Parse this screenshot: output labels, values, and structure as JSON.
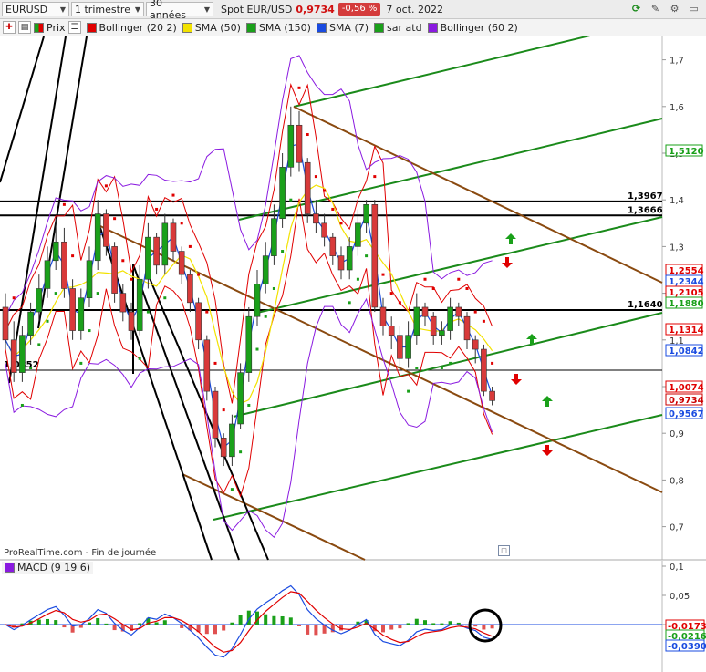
{
  "toolbar": {
    "symbol": "EURUSD",
    "period": "1 trimestre",
    "range": "30 années",
    "spot_label": "Spot EUR/USD",
    "price": "0,9734",
    "change": "-0,56 %",
    "date": "7 oct. 2022",
    "icons": [
      "refresh-icon",
      "drawing-tool-icon",
      "settings-icon",
      "window-icon"
    ]
  },
  "indicators": {
    "price_label": "Prix",
    "items": [
      {
        "label": "Bollinger (20 2)",
        "color": "#e00000"
      },
      {
        "label": "SMA (50)",
        "color": "#f2e200"
      },
      {
        "label": "SMA (150)",
        "color": "#1aa01a"
      },
      {
        "label": "SMA (7)",
        "color": "#1a4be0"
      },
      {
        "label": "sar atd",
        "color": "#1aa01a"
      },
      {
        "label": "Bollinger (60 2)",
        "color": "#8a1ae0"
      }
    ]
  },
  "footer": "ProRealTime.com - Fin de journée",
  "chart_data": {
    "type": "line",
    "title": "",
    "ylim": [
      0.65,
      1.78
    ],
    "price_axis_ticks": [
      "1,7",
      "1,6",
      "1,5",
      "1,4",
      "1,3",
      "1,2",
      "1,1",
      "1",
      "0,9",
      "0,8",
      "0,7"
    ],
    "price_tags": [
      {
        "text": "1,5120",
        "color": "#1aa01a"
      },
      {
        "text": "1,2554",
        "color": "#e00000"
      },
      {
        "text": "1,2344",
        "color": "#1a4be0"
      },
      {
        "text": "1,2105",
        "color": "#e00000"
      },
      {
        "text": "1,1880",
        "color": "#1aa01a"
      },
      {
        "text": "1,1314",
        "color": "#e00000"
      },
      {
        "text": "1,0842",
        "color": "#1a4be0"
      },
      {
        "text": "1,0074",
        "color": "#e00000"
      },
      {
        "text": "0,9734",
        "color": "#cc0000"
      },
      {
        "text": "0,9567",
        "color": "#1a4be0"
      }
    ],
    "level_labels": [
      "1,3967",
      "1,3666",
      "1,1640",
      "1,0352"
    ],
    "price": {
      "open": [
        1.17,
        1.1,
        1.03,
        1.11,
        1.16,
        1.21,
        1.27,
        1.31,
        1.21,
        1.12,
        1.19,
        1.27,
        1.37,
        1.3,
        1.2,
        1.16,
        1.12,
        1.23,
        1.32,
        1.26,
        1.35,
        1.29,
        1.24,
        1.18,
        1.1,
        0.99,
        0.89,
        0.85,
        0.92,
        1.03,
        1.15,
        1.22,
        1.28,
        1.36,
        1.47,
        1.56,
        1.48,
        1.37,
        1.35,
        1.32,
        1.28,
        1.25,
        1.3,
        1.35,
        1.39,
        1.17,
        1.13,
        1.11,
        1.06,
        1.11,
        1.17,
        1.15,
        1.11,
        1.12,
        1.17,
        1.15,
        1.1,
        1.08,
        0.99
      ],
      "close": [
        1.1,
        1.03,
        1.11,
        1.16,
        1.21,
        1.27,
        1.31,
        1.21,
        1.12,
        1.19,
        1.27,
        1.37,
        1.3,
        1.2,
        1.16,
        1.12,
        1.23,
        1.32,
        1.26,
        1.35,
        1.29,
        1.24,
        1.18,
        1.1,
        0.99,
        0.89,
        0.85,
        0.92,
        1.03,
        1.15,
        1.22,
        1.28,
        1.36,
        1.47,
        1.56,
        1.48,
        1.37,
        1.35,
        1.32,
        1.28,
        1.25,
        1.3,
        1.35,
        1.39,
        1.17,
        1.13,
        1.11,
        1.06,
        1.11,
        1.17,
        1.15,
        1.11,
        1.12,
        1.17,
        1.15,
        1.1,
        1.08,
        0.99,
        0.97
      ],
      "high": [
        1.2,
        1.14,
        1.13,
        1.18,
        1.24,
        1.3,
        1.36,
        1.34,
        1.23,
        1.21,
        1.3,
        1.4,
        1.38,
        1.31,
        1.22,
        1.18,
        1.26,
        1.35,
        1.33,
        1.37,
        1.36,
        1.3,
        1.25,
        1.19,
        1.11,
        1.0,
        0.9,
        0.94,
        1.05,
        1.17,
        1.25,
        1.31,
        1.39,
        1.5,
        1.6,
        1.59,
        1.49,
        1.4,
        1.37,
        1.33,
        1.3,
        1.32,
        1.38,
        1.4,
        1.4,
        1.19,
        1.15,
        1.13,
        1.14,
        1.2,
        1.18,
        1.16,
        1.14,
        1.19,
        1.18,
        1.16,
        1.11,
        1.09,
        1.0
      ],
      "low": [
        1.08,
        1.01,
        1.01,
        1.09,
        1.14,
        1.19,
        1.25,
        1.19,
        1.1,
        1.1,
        1.17,
        1.25,
        1.28,
        1.18,
        1.14,
        1.1,
        1.11,
        1.21,
        1.24,
        1.24,
        1.27,
        1.22,
        1.16,
        1.08,
        0.97,
        0.87,
        0.83,
        0.83,
        0.91,
        1.01,
        1.13,
        1.2,
        1.26,
        1.34,
        1.45,
        1.46,
        1.35,
        1.33,
        1.3,
        1.26,
        1.23,
        1.23,
        1.28,
        1.33,
        1.16,
        1.11,
        1.08,
        1.04,
        1.04,
        1.09,
        1.13,
        1.09,
        1.09,
        1.1,
        1.13,
        1.08,
        1.05,
        0.98,
        0.96
      ]
    },
    "macd_ticks": [
      "0,1",
      "0,05",
      "0"
    ],
    "macd_tags": [
      {
        "text": "-0,0173",
        "color": "#e00000"
      },
      {
        "text": "-0,0216",
        "color": "#1aa01a"
      },
      {
        "text": "-0,0390",
        "color": "#1a4be0"
      }
    ],
    "macd_label": "MACD (9 19 6)"
  }
}
